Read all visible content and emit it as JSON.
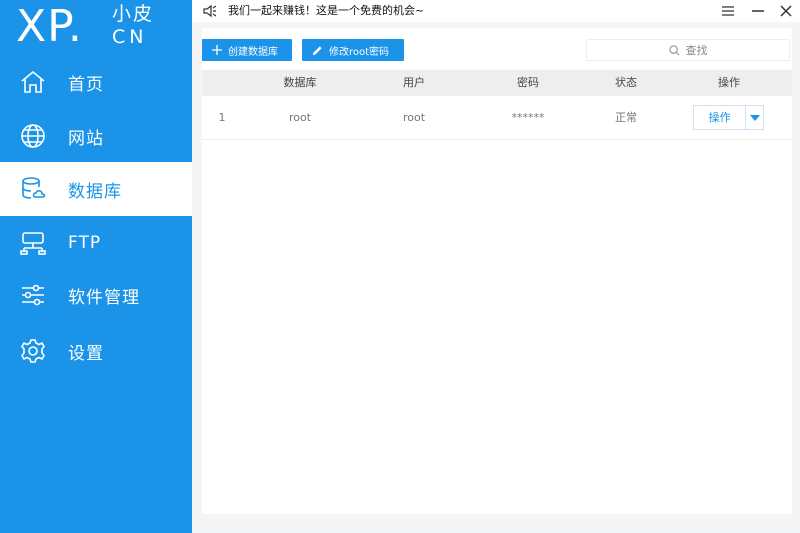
{
  "logo": {
    "main": "XP.",
    "cn_top": "小皮",
    "cn_bottom": "CN"
  },
  "nav": [
    {
      "label": "首页",
      "icon": "home-icon"
    },
    {
      "label": "网站",
      "icon": "globe-icon"
    },
    {
      "label": "数据库",
      "icon": "database-icon",
      "active": true
    },
    {
      "label": "FTP",
      "icon": "ftp-icon"
    },
    {
      "label": "软件管理",
      "icon": "sliders-icon"
    },
    {
      "label": "设置",
      "icon": "gear-icon"
    }
  ],
  "topbar": {
    "notice": "我们一起来赚钱！这是一个免费的机会~"
  },
  "toolbar": {
    "create_label": "创建数据库",
    "change_pwd_label": "修改root密码",
    "search_placeholder": "查找"
  },
  "table": {
    "columns": [
      "数据库",
      "用户",
      "密码",
      "状态",
      "操作"
    ],
    "rows": [
      {
        "index": "1",
        "database": "root",
        "user": "root",
        "password": "******",
        "status": "正常",
        "action": "操作"
      }
    ]
  },
  "colors": {
    "accent": "#1a93e9"
  }
}
